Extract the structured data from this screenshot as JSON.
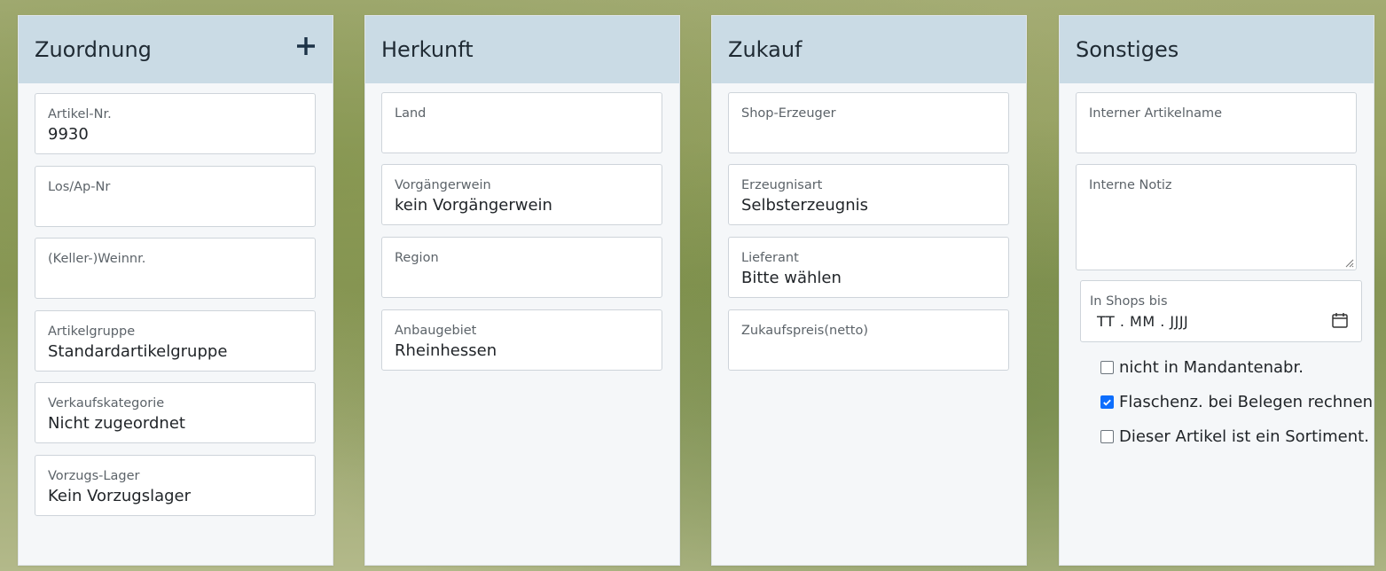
{
  "colors": {
    "header_bg": "#cadbe5",
    "checkbox_accent": "#0d6efd"
  },
  "zuordnung": {
    "title": "Zuordnung",
    "add_icon": "plus-icon",
    "fields": [
      {
        "label": "Artikel-Nr.",
        "value": "9930"
      },
      {
        "label": "Los/Ap-Nr",
        "value": ""
      },
      {
        "label": "(Keller-)Weinnr.",
        "value": ""
      },
      {
        "label": "Artikelgruppe",
        "value": "Standardartikelgruppe"
      },
      {
        "label": "Verkaufskategorie",
        "value": "Nicht zugeordnet"
      },
      {
        "label": "Vorzugs-Lager",
        "value": "Kein Vorzugslager"
      }
    ]
  },
  "herkunft": {
    "title": "Herkunft",
    "fields": [
      {
        "label": "Land",
        "value": ""
      },
      {
        "label": "Vorgängerwein",
        "value": "kein Vorgängerwein"
      },
      {
        "label": "Region",
        "value": ""
      },
      {
        "label": "Anbaugebiet",
        "value": "Rheinhessen"
      }
    ]
  },
  "zukauf": {
    "title": "Zukauf",
    "fields": [
      {
        "label": "Shop-Erzeuger",
        "value": ""
      },
      {
        "label": "Erzeugnisart",
        "value": "Selbsterzeugnis"
      },
      {
        "label": "Lieferant",
        "value": "Bitte wählen"
      },
      {
        "label": "Zukaufspreis(netto)",
        "value": ""
      }
    ]
  },
  "sonstiges": {
    "title": "Sonstiges",
    "internal_name": {
      "label": "Interner Artikelname",
      "value": ""
    },
    "internal_note": {
      "label": "Interne Notiz",
      "value": ""
    },
    "shops_until": {
      "label": "In Shops bis",
      "placeholder": "TT . MM . JJJJ",
      "icon": "calendar-icon"
    },
    "checkboxes": [
      {
        "label": "nicht in Mandantenabr.",
        "checked": false
      },
      {
        "label": "Flaschenz. bei Belegen rechnen",
        "checked": true
      },
      {
        "label": "Dieser Artikel ist ein Sortiment.",
        "checked": false
      }
    ]
  }
}
